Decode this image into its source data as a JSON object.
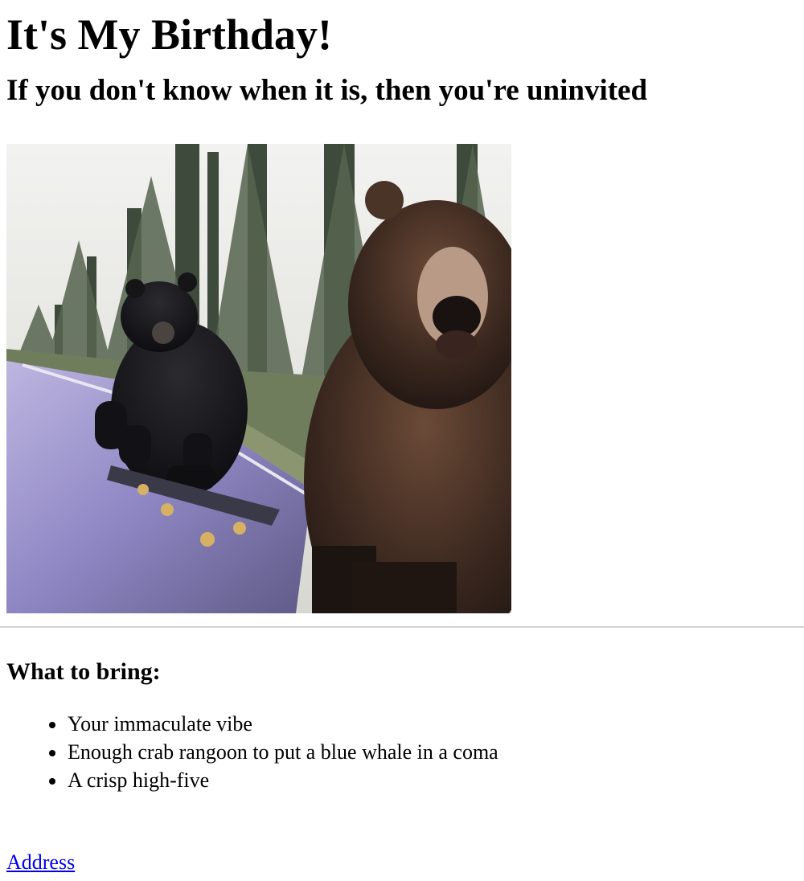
{
  "page": {
    "title": "It's My Birthday!",
    "subtitle": "If you don't know when it is, then you're uninvited"
  },
  "photo": {
    "description_icon": "bears-skateboarding-photo"
  },
  "bring": {
    "heading": "What to bring:",
    "items": [
      "Your immaculate vibe",
      "Enough crab rangoon to put a blue whale in a coma",
      "A crisp high-five"
    ]
  },
  "links": {
    "address": "Address"
  },
  "colors": {
    "link": "#0000ee",
    "rule": "#d3d3d3",
    "road": "#8f87c4"
  }
}
